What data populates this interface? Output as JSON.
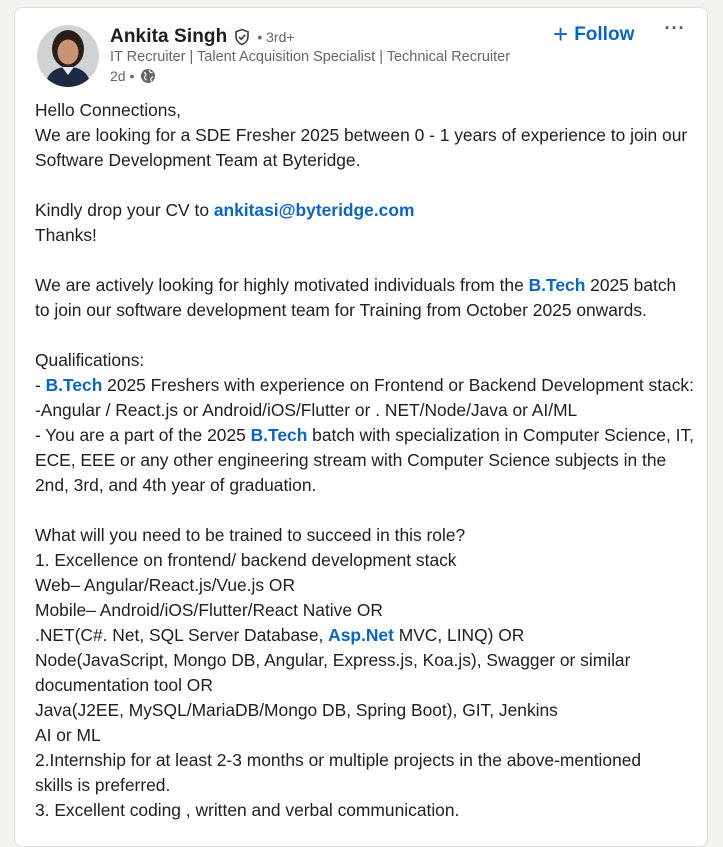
{
  "author": {
    "name": "Ankita Singh",
    "degree": "• 3rd+",
    "headline": "IT Recruiter | Talent Acquisition Specialist | Technical Recruiter",
    "time": "2d •"
  },
  "actions": {
    "follow_label": "Follow",
    "more_label": "···"
  },
  "post": {
    "l1": "Hello Connections,",
    "l2": "We are looking for a SDE Fresher 2025 between 0 - 1 years of experience to join our",
    "l3": "Software Development Team at Byteridge.",
    "l4a": "Kindly drop your CV to ",
    "l4link": "ankitasi@byteridge.com",
    "l5": "Thanks!",
    "l6a": "We are actively looking for highly motivated individuals from the ",
    "l6link": "B.Tech",
    "l6b": " 2025 batch",
    "l7": "to join our software development team for Training from October 2025 onwards.",
    "l8": "Qualifications:",
    "l9a": "- ",
    "l9link": "B.Tech",
    "l9b": " 2025 Freshers with experience on Frontend or Backend Development stack:",
    "l10": "-Angular / React.js or Android/iOS/Flutter or . NET/Node/Java or AI/ML",
    "l11a": "- You are a part of the 2025 ",
    "l11link": "B.Tech",
    "l11b": " batch with specialization in Computer Science, IT,",
    "l12": "ECE, EEE or any other engineering stream with Computer Science subjects in the",
    "l13": "2nd, 3rd, and 4th year of graduation.",
    "l14": "What will you need to be trained to succeed in this role?",
    "l15": "1. Excellence on frontend/ backend development stack",
    "l16": "Web– Angular/React.js/Vue.js OR",
    "l17": "Mobile– Android/iOS/Flutter/React Native OR",
    "l18a": ".NET(C#. Net, SQL Server Database, ",
    "l18link": "Asp.Net",
    "l18b": " MVC, LINQ) OR",
    "l19": "Node(JavaScript, Mongo DB, Angular, Express.js, Koa.js), Swagger or similar",
    "l20": "documentation tool OR",
    "l21": "Java(J2EE, MySQL/MariaDB/Mongo DB, Spring Boot), GIT, Jenkins",
    "l22": "AI or ML",
    "l23": "2.Internship for at least 2-3 months or multiple projects in the above-mentioned",
    "l24": "skills is preferred.",
    "l25": "3. Excellent coding , written and verbal communication."
  },
  "colors": {
    "link": "#0a66c2",
    "muted": "#666666",
    "card_bg": "#ffffff",
    "page_bg": "#f4f2ee"
  },
  "icons": {
    "verified": "verified-shield-icon",
    "visibility": "globe-icon",
    "follow": "plus-icon",
    "more": "ellipsis-icon"
  }
}
